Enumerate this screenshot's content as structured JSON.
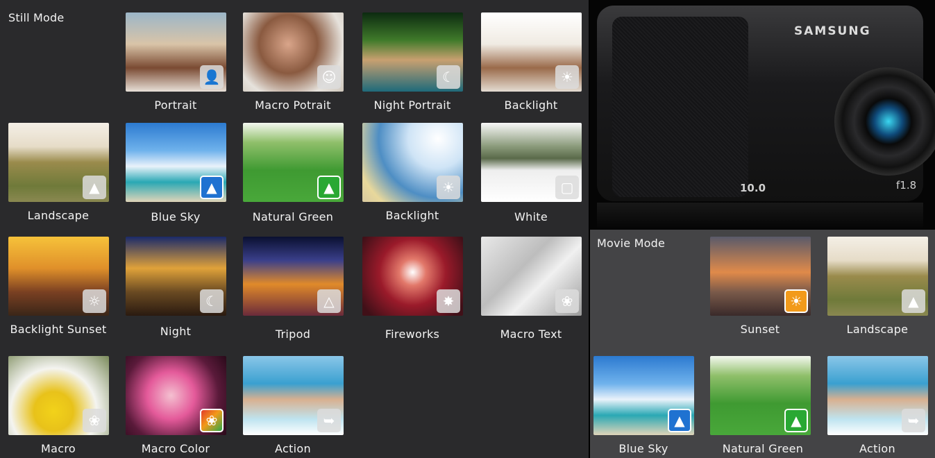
{
  "still_mode": {
    "title": "Still Mode",
    "items": [
      {
        "label": "Portrait",
        "icon": "portrait-scene-icon",
        "badge": "grey"
      },
      {
        "label": "Macro Potrait",
        "icon": "macro-portrait-scene-icon",
        "badge": "grey"
      },
      {
        "label": "Night Portrait",
        "icon": "night-portrait-scene-icon",
        "badge": "grey"
      },
      {
        "label": "Backlight",
        "icon": "backlight-portrait-scene-icon",
        "badge": "grey"
      },
      {
        "label": "Landscape",
        "icon": "landscape-scene-icon",
        "badge": "grey"
      },
      {
        "label": "Blue Sky",
        "icon": "blue-sky-scene-icon",
        "badge": "blue"
      },
      {
        "label": "Natural Green",
        "icon": "natural-green-scene-icon",
        "badge": "green"
      },
      {
        "label": "Backlight",
        "icon": "backlight-scene-icon",
        "badge": "grey"
      },
      {
        "label": "White",
        "icon": "white-scene-icon",
        "badge": "grey"
      },
      {
        "label": "Backlight Sunset",
        "icon": "backlight-sunset-scene-icon",
        "badge": "grey"
      },
      {
        "label": "Night",
        "icon": "night-scene-icon",
        "badge": "grey"
      },
      {
        "label": "Tripod",
        "icon": "tripod-scene-icon",
        "badge": "grey"
      },
      {
        "label": "Fireworks",
        "icon": "fireworks-scene-icon",
        "badge": "grey"
      },
      {
        "label": "Macro Text",
        "icon": "macro-text-scene-icon",
        "badge": "grey"
      },
      {
        "label": "Macro",
        "icon": "macro-scene-icon",
        "badge": "grey"
      },
      {
        "label": "Macro Color",
        "icon": "macro-color-scene-icon",
        "badge": "multi"
      },
      {
        "label": "Action",
        "icon": "action-scene-icon",
        "badge": "grey"
      }
    ]
  },
  "movie_mode": {
    "title": "Movie Mode",
    "items": [
      {
        "label": "Sunset",
        "icon": "sunset-scene-icon",
        "badge": "orange"
      },
      {
        "label": "Landscape",
        "icon": "landscape-scene-icon",
        "badge": "grey"
      },
      {
        "label": "Blue Sky",
        "icon": "blue-sky-scene-icon",
        "badge": "blue"
      },
      {
        "label": "Natural Green",
        "icon": "natural-green-scene-icon",
        "badge": "green"
      },
      {
        "label": "Action",
        "icon": "action-scene-icon",
        "badge": "grey"
      }
    ]
  },
  "camera": {
    "brand": "SAMSUNG",
    "megapixels": "10.0",
    "aperture": "f1.8"
  }
}
